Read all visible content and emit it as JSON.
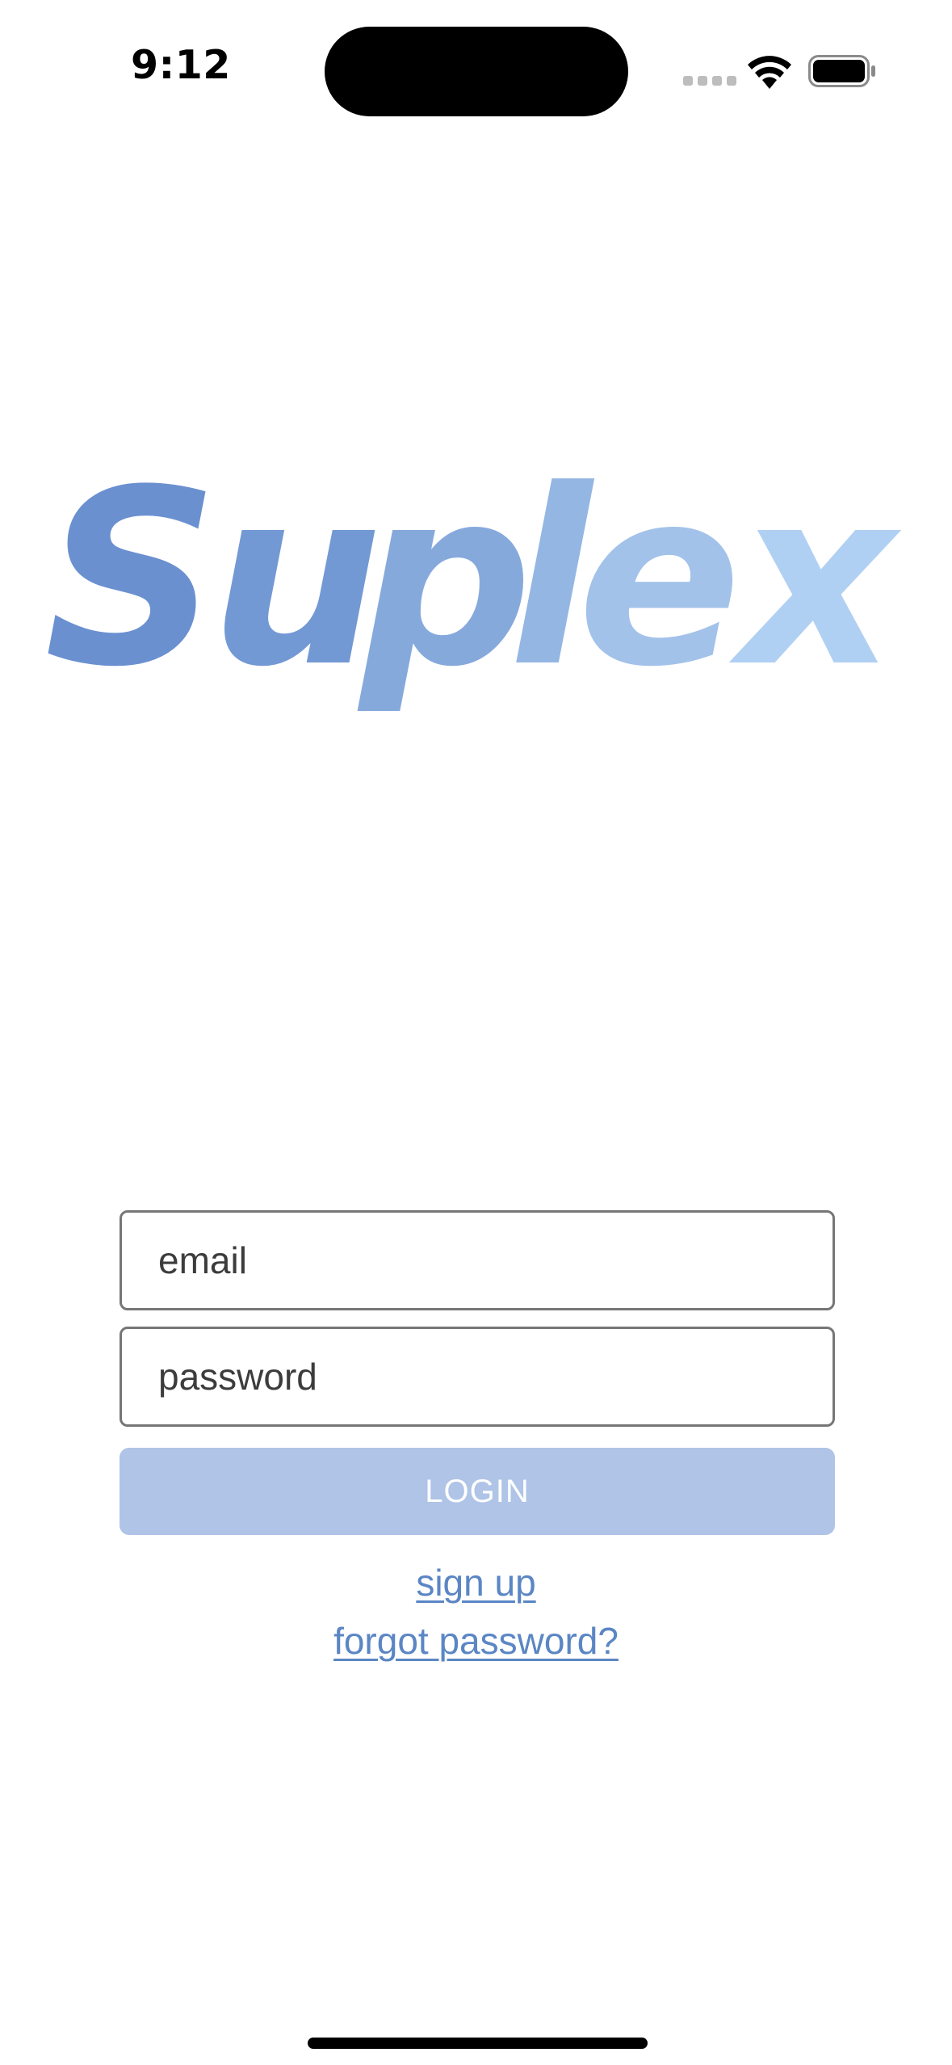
{
  "status_bar": {
    "time": "9:12"
  },
  "logo": {
    "text": "Suplex",
    "colors": [
      "#6a90d0",
      "#7399d4",
      "#86a9dc",
      "#94b6e3",
      "#a3c2ea",
      "#b0d0f3"
    ]
  },
  "login_form": {
    "email_placeholder": "email",
    "password_placeholder": "password",
    "login_label": "LOGIN",
    "login_button_color": "#afc4e6"
  },
  "links": {
    "sign_up": "sign up",
    "forgot_password": "forgot password?",
    "link_color": "#5b86c4"
  },
  "icons": {
    "wifi": "wifi-icon",
    "battery": "battery-icon",
    "signal": "cellular-signal-icon"
  }
}
